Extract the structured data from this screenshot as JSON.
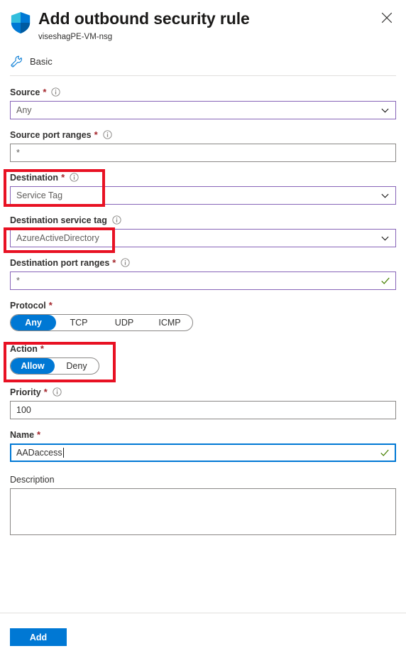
{
  "header": {
    "title": "Add outbound security rule",
    "subtitle": "viseshagPE-VM-nsg",
    "shield_icon": "shield-icon",
    "close_icon": "close-icon",
    "close_label": "✕"
  },
  "toolbar": {
    "basic_label": "Basic",
    "basic_icon": "wrench-icon"
  },
  "form": {
    "source": {
      "label": "Source",
      "required": "*",
      "info_icon": "info-icon",
      "value": "Any",
      "chevron_icon": "chevron-down-icon"
    },
    "source_port_ranges": {
      "label": "Source port ranges",
      "required": "*",
      "info_icon": "info-icon",
      "value": "*"
    },
    "destination": {
      "label": "Destination",
      "required": "*",
      "info_icon": "info-icon",
      "value": "Service Tag",
      "chevron_icon": "chevron-down-icon"
    },
    "destination_service_tag": {
      "label": "Destination service tag",
      "info_icon": "info-icon",
      "value": "AzureActiveDirectory",
      "chevron_icon": "chevron-down-icon"
    },
    "destination_port_ranges": {
      "label": "Destination port ranges",
      "required": "*",
      "info_icon": "info-icon",
      "value": "*",
      "valid_icon": "checkmark-icon"
    },
    "protocol": {
      "label": "Protocol",
      "required": "*",
      "options": [
        "Any",
        "TCP",
        "UDP",
        "ICMP"
      ],
      "selected": "Any"
    },
    "action": {
      "label": "Action",
      "required": "*",
      "options": [
        "Allow",
        "Deny"
      ],
      "selected": "Allow"
    },
    "priority": {
      "label": "Priority",
      "required": "*",
      "info_icon": "info-icon",
      "value": "100"
    },
    "name": {
      "label": "Name",
      "required": "*",
      "value": "AADaccess",
      "valid_icon": "checkmark-icon"
    },
    "description": {
      "label": "Description",
      "value": "",
      "placeholder": ""
    }
  },
  "footer": {
    "add_label": "Add"
  },
  "colors": {
    "accent_blue": "#0078d4",
    "annotation_red": "#e81123",
    "required_red": "#a4262c",
    "field_purple": "#8764b8",
    "field_gray": "#8a8886",
    "valid_green": "#498205"
  },
  "annotations": [
    {
      "name": "destination-highlight"
    },
    {
      "name": "destination-service-tag-highlight"
    },
    {
      "name": "action-highlight"
    }
  ]
}
